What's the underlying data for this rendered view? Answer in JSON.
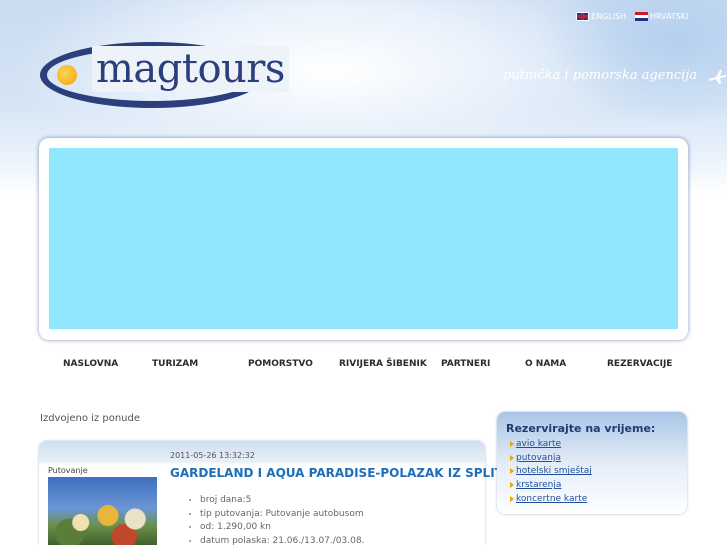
{
  "header": {
    "languages": [
      {
        "label": "ENGLISH",
        "flag": "uk-flag-icon"
      },
      {
        "label": "HRVATSKI",
        "flag": "croatia-flag-icon"
      }
    ],
    "logo_text": "magtours",
    "tagline": "putnička i pomorska agencija",
    "banner_color": "#8fe6fd"
  },
  "nav": {
    "items": [
      "NASLOVNA",
      "TURIZAM",
      "POMORSTVO",
      "RIVIJERA ŠIBENIK",
      "PARTNERI",
      "O NAMA",
      "REZERVACIJE"
    ]
  },
  "main": {
    "section_title": "Izdvojeno iz ponude",
    "featured": {
      "date": "2011-05-26 13:32:32",
      "category": "Putovanje",
      "title": "GARDELAND I AQUA PARADISE-POLAZAK IZ SPLITA",
      "details": [
        "broj dana:5",
        "tip putovanja: Putovanje autobusom",
        "od: 1.290,00 kn",
        "datum polaska: 21.06./13.07./03.08."
      ]
    }
  },
  "sidebar": {
    "title": "Rezervirajte na vrijeme:",
    "links": [
      "avio karte",
      "putovanja",
      "hotelski smještaj",
      "krstarenja",
      "koncertne karte"
    ]
  },
  "colors": {
    "brand": "#2a3f7c",
    "accent": "#f0a500",
    "link": "#1c6fb8"
  }
}
